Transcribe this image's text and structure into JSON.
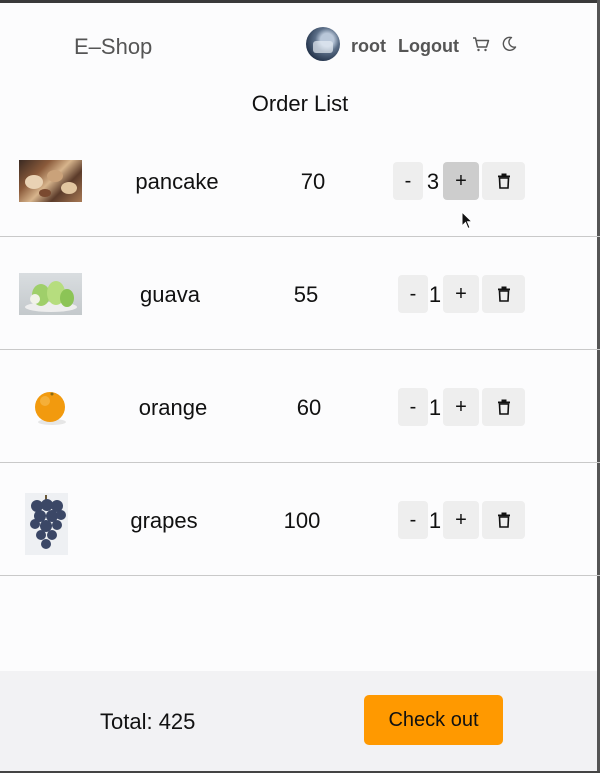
{
  "header": {
    "brand": "E–Shop",
    "user": "root",
    "logout_label": "Logout",
    "cart_icon": "cart-icon",
    "theme_icon": "moon-icon"
  },
  "page_title": "Order List",
  "orders": [
    {
      "name": "pancake",
      "price": "70",
      "quantity": "3",
      "minus_label": "-",
      "plus_label": "+",
      "image": "pancake-photo"
    },
    {
      "name": "guava",
      "price": "55",
      "quantity": "1",
      "minus_label": "-",
      "plus_label": "+",
      "image": "guava-photo"
    },
    {
      "name": "orange",
      "price": "60",
      "quantity": "1",
      "minus_label": "-",
      "plus_label": "+",
      "image": "orange-photo"
    },
    {
      "name": "grapes",
      "price": "100",
      "quantity": "1",
      "minus_label": "-",
      "plus_label": "+",
      "image": "grapes-photo"
    }
  ],
  "footer": {
    "total": "Total: 425",
    "checkout_label": "Check out"
  },
  "colors": {
    "accent": "#ff9900",
    "button_bg": "#eeeeee",
    "button_pressed": "#cdcdcd"
  }
}
